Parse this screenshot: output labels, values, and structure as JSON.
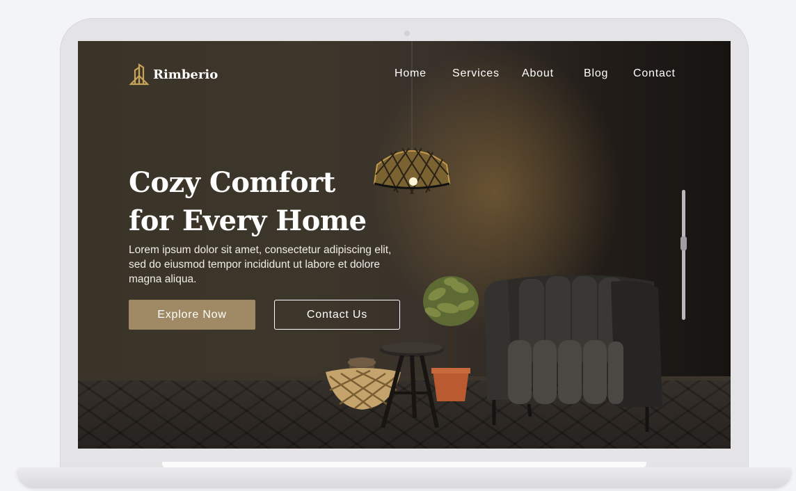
{
  "brand": {
    "name": "Rimberio",
    "accent": "#c8a45a"
  },
  "nav": {
    "items": [
      {
        "label": "Home"
      },
      {
        "label": "Services"
      },
      {
        "label": "About"
      },
      {
        "label": "Blog"
      },
      {
        "label": "Contact"
      }
    ]
  },
  "hero": {
    "title_line1": "Cozy Comfort",
    "title_line2": "for Every Home",
    "description": "Lorem ipsum dolor sit amet, consectetur adipiscing elit, sed do eiusmod tempor incididunt ut labore et dolore magna aliqua.",
    "primary_button": "Explore Now",
    "secondary_button": "Contact Us",
    "button_color": "#a08a65"
  },
  "slider": {
    "level": 0.4
  },
  "icons": {
    "logo": "building-logo-icon",
    "lamp": "pendant-lamp",
    "armchair": "armchair",
    "plant": "potted-plant"
  }
}
